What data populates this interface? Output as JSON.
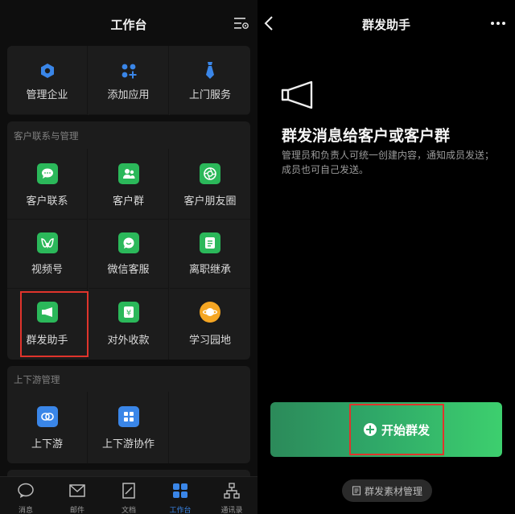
{
  "left": {
    "title": "工作台",
    "top_items": [
      {
        "label": "管理企业",
        "icon": "hexagon-icon"
      },
      {
        "label": "添加应用",
        "icon": "add-apps-icon"
      },
      {
        "label": "上门服务",
        "icon": "tie-icon"
      }
    ],
    "section1": {
      "title": "客户联系与管理",
      "items": [
        {
          "label": "客户联系",
          "icon": "chat-bubble-icon"
        },
        {
          "label": "客户群",
          "icon": "group-icon"
        },
        {
          "label": "客户朋友圈",
          "icon": "aperture-icon"
        },
        {
          "label": "视频号",
          "icon": "video-channel-icon"
        },
        {
          "label": "微信客服",
          "icon": "service-chat-icon"
        },
        {
          "label": "离职继承",
          "icon": "document-icon"
        },
        {
          "label": "群发助手",
          "icon": "megaphone-icon"
        },
        {
          "label": "对外收款",
          "icon": "yuan-icon"
        },
        {
          "label": "学习园地",
          "icon": "planet-icon"
        }
      ]
    },
    "section2": {
      "title": "上下游管理",
      "items": [
        {
          "label": "上下游",
          "icon": "link-icon"
        },
        {
          "label": "上下游协作",
          "icon": "grid-apps-icon"
        }
      ]
    },
    "tabs": [
      {
        "label": "消息",
        "icon": "message-icon"
      },
      {
        "label": "邮件",
        "icon": "mail-icon"
      },
      {
        "label": "文档",
        "icon": "doc-icon"
      },
      {
        "label": "工作台",
        "icon": "workbench-icon",
        "active": true
      },
      {
        "label": "通讯录",
        "icon": "contacts-icon"
      }
    ]
  },
  "right": {
    "title": "群发助手",
    "heading": "群发消息给客户或客户群",
    "description": "管理员和负责人可统一创建内容，通知成员发送；成员也可自己发送。",
    "start_button": "开始群发",
    "material_button": "群发素材管理"
  },
  "colors": {
    "accent_green": "#2bb85a",
    "accent_blue": "#3a86e8",
    "highlight_red": "#e0342c"
  }
}
